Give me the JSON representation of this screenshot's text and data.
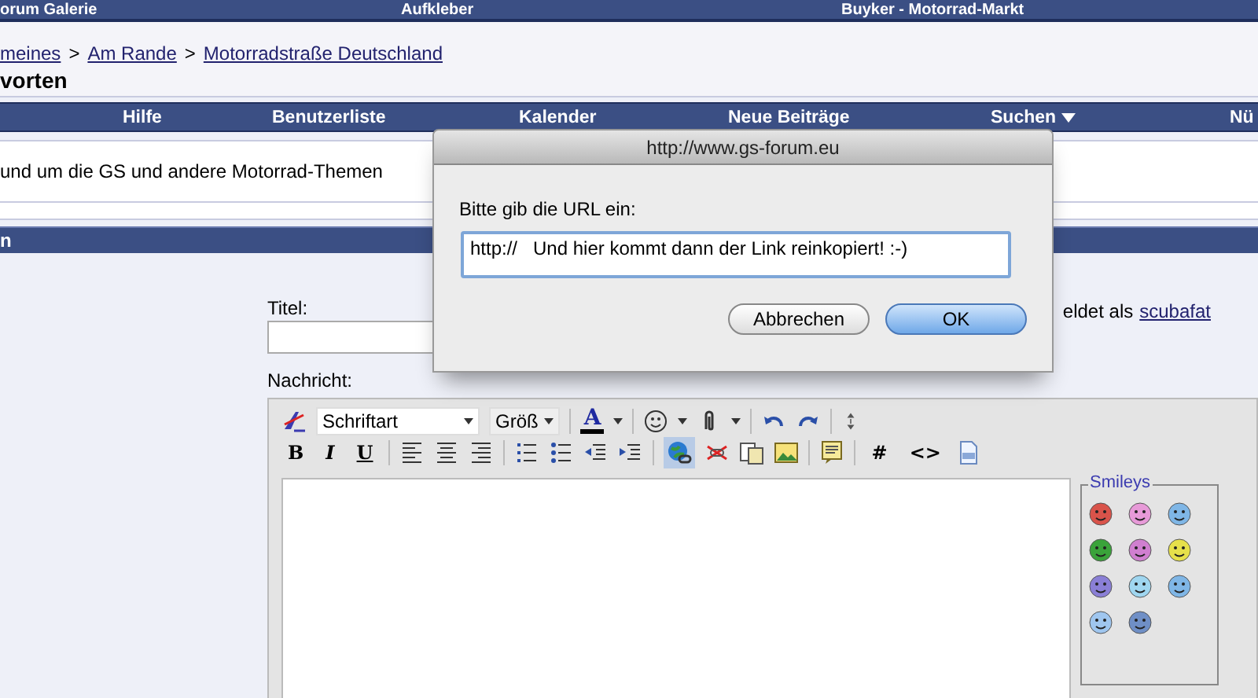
{
  "top_links": [
    "orum Galerie",
    "Aufkleber",
    "Buyker - Motorrad-Markt"
  ],
  "breadcrumb": [
    "meines",
    "Am Rande",
    "Motorradstraße Deutschland"
  ],
  "breadcrumb_separator": ">",
  "page_title": "vorten",
  "nav": [
    {
      "label": "Hilfe"
    },
    {
      "label": "Benutzerliste"
    },
    {
      "label": "Kalender"
    },
    {
      "label": "Neue Beiträge"
    },
    {
      "label": "Suchen",
      "dropdown": true
    },
    {
      "label": "Nü"
    }
  ],
  "forum_description": "und um die GS und andere Motorrad-Themen",
  "section_header": "n",
  "form": {
    "title_label": "Titel:",
    "logged_in_prefix": "eldet als",
    "logged_in_user": "scubafat",
    "message_label": "Nachricht:"
  },
  "editor": {
    "font_select": "Schriftart",
    "size_select": "Größ",
    "color_letter": "A",
    "format_buttons": [
      {
        "label": "B"
      },
      {
        "label": "I"
      },
      {
        "label": "U"
      }
    ],
    "insert_link_active": true,
    "code_buttons": [
      {
        "label": "#"
      },
      {
        "label": "<>"
      }
    ],
    "smileys_legend": "Smileys"
  },
  "dialog": {
    "title": "http://www.gs-forum.eu",
    "prompt": "Bitte gib die URL ein:",
    "value": "http://   Und hier kommt dann der Link reinkopiert! :-)",
    "buttons": [
      {
        "label": "Abbrechen",
        "default": false
      },
      {
        "label": "OK",
        "default": true
      }
    ]
  }
}
